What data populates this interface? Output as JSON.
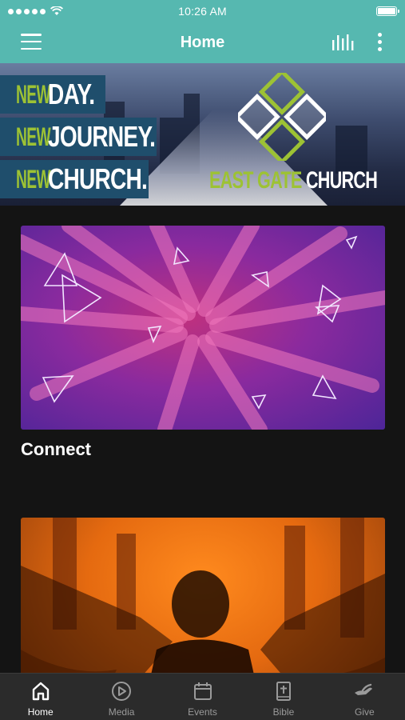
{
  "status_bar": {
    "time": "10:26 AM"
  },
  "nav": {
    "title": "Home"
  },
  "banner": {
    "lines": [
      {
        "prefix": "NEW",
        "word": "DAY."
      },
      {
        "prefix": "NEW",
        "word": "JOURNEY."
      },
      {
        "prefix": "NEW",
        "word": "CHURCH."
      }
    ],
    "logo_text_part1": "EAST GATE",
    "logo_text_part2": "CHURCH"
  },
  "cards": [
    {
      "label": "Connect"
    },
    {
      "label": ""
    }
  ],
  "tabs": [
    {
      "label": "Home",
      "icon": "home-icon",
      "active": true
    },
    {
      "label": "Media",
      "icon": "play-circle-icon",
      "active": false
    },
    {
      "label": "Events",
      "icon": "calendar-icon",
      "active": false
    },
    {
      "label": "Bible",
      "icon": "bible-icon",
      "active": false
    },
    {
      "label": "Give",
      "icon": "give-hand-icon",
      "active": false
    }
  ],
  "colors": {
    "header": "#56b8b0",
    "background": "#141414",
    "tabbar": "#2b2b2b",
    "accent_green": "#9dc234"
  }
}
